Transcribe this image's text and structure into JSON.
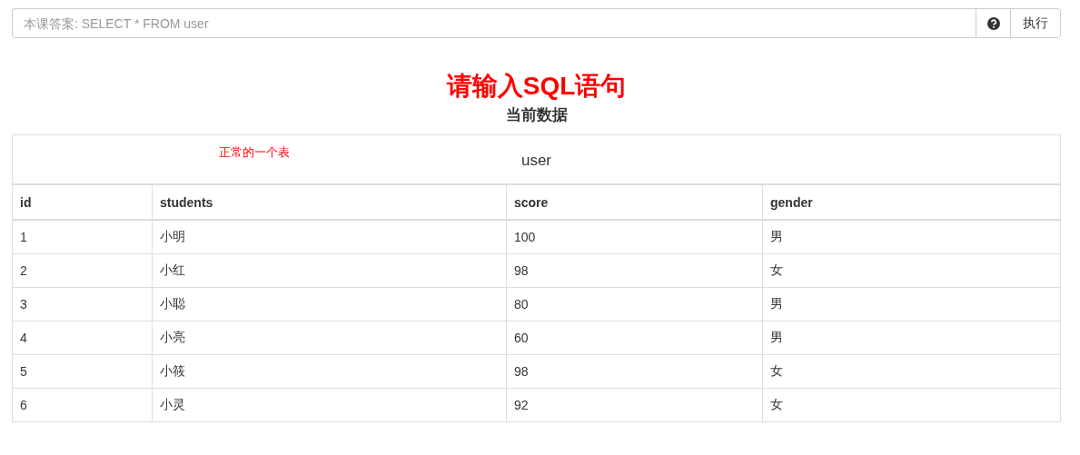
{
  "query_bar": {
    "placeholder": "本课答案: SELECT * FROM user",
    "run_button": "执行"
  },
  "heading": "请输入SQL语句",
  "subheading": "当前数据",
  "table": {
    "note": "正常的一个表",
    "caption": "user",
    "columns": [
      "id",
      "students",
      "score",
      "gender"
    ],
    "rows": [
      [
        "1",
        "小明",
        "100",
        "男"
      ],
      [
        "2",
        "小红",
        "98",
        "女"
      ],
      [
        "3",
        "小聪",
        "80",
        "男"
      ],
      [
        "4",
        "小亮",
        "60",
        "男"
      ],
      [
        "5",
        "小筱",
        "98",
        "女"
      ],
      [
        "6",
        "小灵",
        "92",
        "女"
      ]
    ]
  }
}
